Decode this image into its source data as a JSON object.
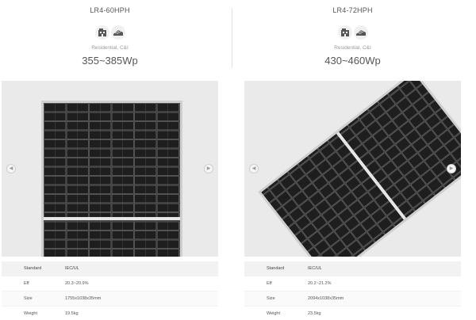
{
  "products": [
    {
      "model": "LR4-60HPH",
      "segment": "Residential, C&I",
      "power": "355~385Wp",
      "specs": {
        "standard_label": "Standard",
        "standard_value": "IEC/UL",
        "eff_label": "Eff",
        "eff_value": "20.3~20.9%",
        "size_label": "Size",
        "size_value": "1755x1038x35mm",
        "weight_label": "Weight",
        "weight_value": "19.5kg"
      }
    },
    {
      "model": "LR4-72HPH",
      "segment": "Residential, C&I",
      "power": "430~460Wp",
      "specs": {
        "standard_label": "Standard",
        "standard_value": "IEC/UL",
        "eff_label": "Eff",
        "eff_value": "20.2~21.2%",
        "size_label": "Size",
        "size_value": "2094x1038x35mm",
        "weight_label": "Weight",
        "weight_value": "23.5kg"
      }
    }
  ],
  "icons": [
    "home-icon",
    "factory-roof-icon"
  ],
  "nav": {
    "prev_glyph": "◀",
    "next_glyph": "▶"
  }
}
